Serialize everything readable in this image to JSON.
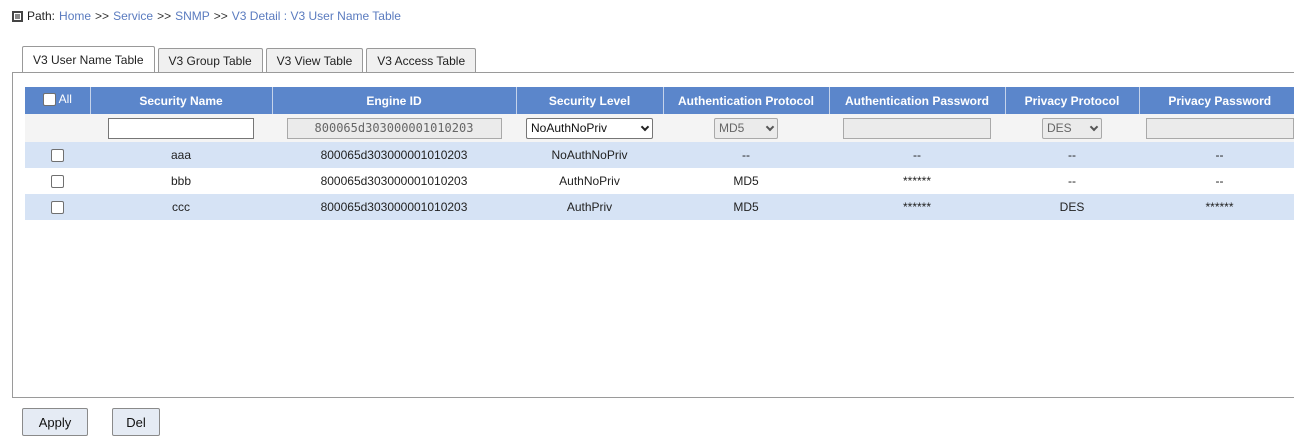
{
  "path": {
    "label": "Path:",
    "crumbs": [
      "Home",
      "Service",
      "SNMP",
      "V3 Detail : V3 User Name Table"
    ],
    "separator": ">>"
  },
  "tabs": [
    {
      "label": "V3 User Name Table",
      "active": true
    },
    {
      "label": "V3 Group Table",
      "active": false
    },
    {
      "label": "V3 View Table",
      "active": false
    },
    {
      "label": "V3 Access Table",
      "active": false
    }
  ],
  "table": {
    "headers": {
      "all": "All",
      "security_name": "Security Name",
      "engine_id": "Engine ID",
      "security_level": "Security Level",
      "auth_protocol": "Authentication Protocol",
      "auth_password": "Authentication Password",
      "privacy_protocol": "Privacy Protocol",
      "privacy_password": "Privacy Password"
    },
    "filter": {
      "security_name": "",
      "engine_id": "800065d303000001010203",
      "security_level": "NoAuthNoPriv",
      "auth_protocol": "MD5",
      "auth_password": "",
      "privacy_protocol": "DES",
      "privacy_password": ""
    },
    "rows": [
      {
        "name": "aaa",
        "engine": "800065d303000001010203",
        "level": "NoAuthNoPriv",
        "auth": "--",
        "auth_pw": "--",
        "priv": "--",
        "priv_pw": "--"
      },
      {
        "name": "bbb",
        "engine": "800065d303000001010203",
        "level": "AuthNoPriv",
        "auth": "MD5",
        "auth_pw": "******",
        "priv": "--",
        "priv_pw": "--"
      },
      {
        "name": "ccc",
        "engine": "800065d303000001010203",
        "level": "AuthPriv",
        "auth": "MD5",
        "auth_pw": "******",
        "priv": "DES",
        "priv_pw": "******"
      }
    ]
  },
  "buttons": {
    "apply": "Apply",
    "del": "Del"
  },
  "colors": {
    "header": "#5b86cb",
    "row_alt": "#d6e3f5",
    "link": "#5a7bbf"
  }
}
